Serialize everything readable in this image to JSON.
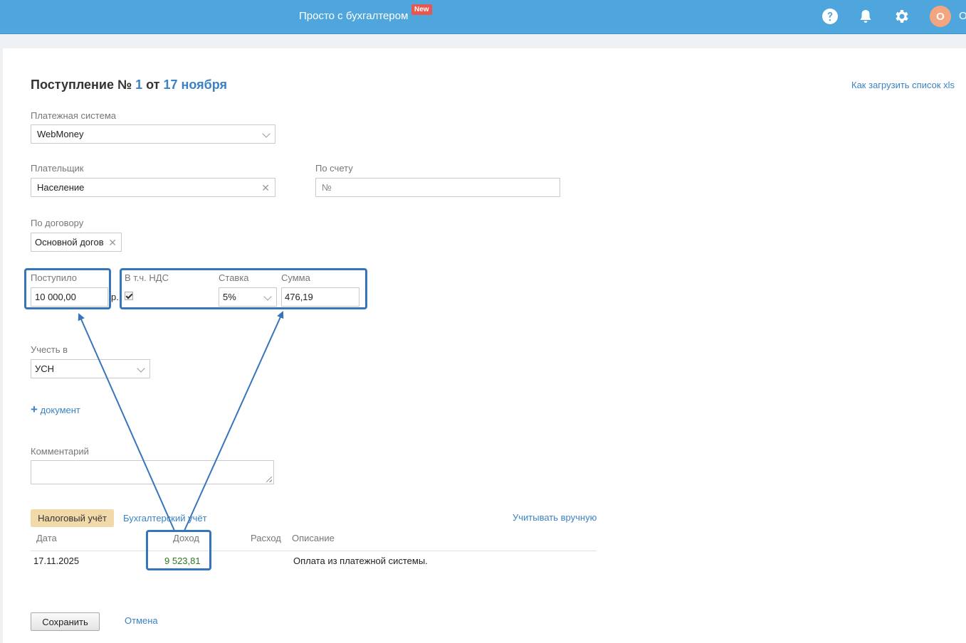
{
  "header": {
    "app_title": "Просто с бухгалтером",
    "new_badge": "New",
    "avatar_letter": "О",
    "user_initial": "О",
    "icons": [
      "help-icon",
      "bell-icon",
      "gear-icon"
    ]
  },
  "page": {
    "title_prefix": "Поступление №",
    "number": "1",
    "title_from": "от",
    "date": "17 ноября",
    "xls_link": "Как загрузить список xls"
  },
  "form": {
    "payment_system": {
      "label": "Платежная система",
      "value": "WebMoney"
    },
    "payer": {
      "label": "Плательщик",
      "value": "Население"
    },
    "invoice": {
      "label": "По счету",
      "placeholder": "№"
    },
    "contract": {
      "label": "По договору",
      "value": "Основной догов"
    },
    "received": {
      "label": "Поступило",
      "value": "10 000,00",
      "currency": "р."
    },
    "vat_included": {
      "label": "В т.ч. НДС",
      "checked": true
    },
    "rate": {
      "label": "Ставка",
      "value": "5%"
    },
    "sum": {
      "label": "Сумма",
      "value": "476,19"
    },
    "account_in": {
      "label": "Учесть в",
      "value": "УСН"
    },
    "add_document": {
      "plus": "+",
      "label": "документ"
    },
    "comment": {
      "label": "Комментарий",
      "value": ""
    }
  },
  "accounting": {
    "tabs": [
      {
        "label": "Налоговый учёт",
        "active": true
      },
      {
        "label": "Бухгалтерский учёт",
        "active": false
      }
    ],
    "manual_link": "Учитывать вручную",
    "columns": [
      "Дата",
      "Доход",
      "Расход",
      "Описание"
    ],
    "rows": [
      {
        "date": "17.11.2025",
        "income": "9 523,81",
        "expense": "",
        "description": "Оплата из платежной системы."
      }
    ]
  },
  "actions": {
    "save": "Сохранить",
    "cancel": "Отмена"
  },
  "colors": {
    "header": "#4ea6dc",
    "accent": "#3b82c4",
    "highlight": "#3675b9",
    "tab_active": "#f2d9aa",
    "income": "#2b7a1f"
  }
}
